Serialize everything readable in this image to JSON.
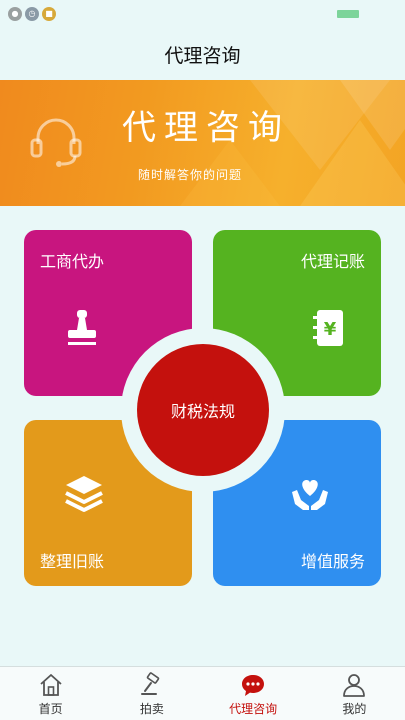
{
  "status_bar": {
    "icons": [
      "lock-icon",
      "clock-icon",
      "notification-icon"
    ],
    "battery_icon": "battery-icon"
  },
  "header": {
    "title": "代理咨询"
  },
  "banner": {
    "title": "代理咨询",
    "subtitle": "随时解答你的问题",
    "icon": "headset-icon"
  },
  "tiles": [
    {
      "label": "工商代办",
      "icon": "stamp-icon",
      "color": "#c8157f"
    },
    {
      "label": "代理记账",
      "icon": "ledger-yuan-icon",
      "color": "#55b320"
    },
    {
      "label": "整理旧账",
      "icon": "layers-icon",
      "color": "#e39a1b"
    },
    {
      "label": "增值服务",
      "icon": "hands-heart-icon",
      "color": "#2f8ff0"
    }
  ],
  "center": {
    "label": "财税法规",
    "color": "#c4110d"
  },
  "bottom_nav": {
    "items": [
      {
        "label": "首页",
        "icon": "home-icon"
      },
      {
        "label": "拍卖",
        "icon": "gavel-icon"
      },
      {
        "label": "代理咨询",
        "icon": "chat-bubble-icon",
        "active": true
      },
      {
        "label": "我的",
        "icon": "person-icon"
      }
    ],
    "active_color": "#c4110d"
  }
}
